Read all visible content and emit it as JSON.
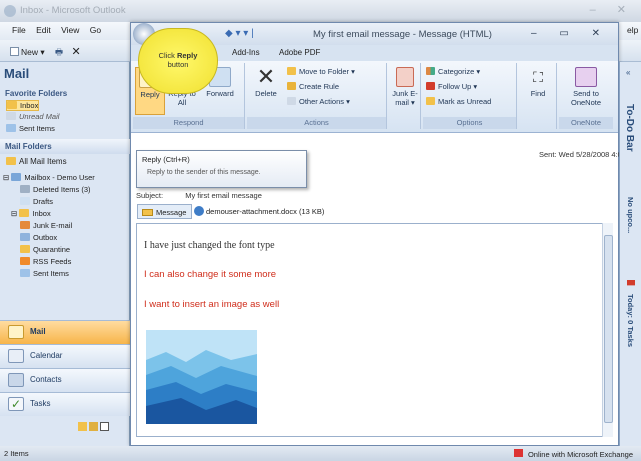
{
  "outer_window": {
    "title": "Inbox - Microsoft Outlook",
    "controls": "–  ✕"
  },
  "menu": [
    "File",
    "Edit",
    "View",
    "Go"
  ],
  "toolbar": {
    "new_label": "New",
    "help_label": "elp"
  },
  "nav": {
    "header": "Mail",
    "favorite_folders_label": "Favorite Folders",
    "favorites": [
      "Inbox",
      "Unread Mail",
      "Sent Items"
    ],
    "mail_folders_label": "Mail Folders",
    "all_mail_items": "All Mail Items",
    "mailbox_label": "Mailbox - Demo User",
    "folders": [
      "Deleted Items (3)",
      "Drafts",
      "Inbox",
      "Junk E-mail",
      "Outbox",
      "Quarantine",
      "RSS Feeds",
      "Sent Items"
    ],
    "buttons": [
      "Mail",
      "Calendar",
      "Contacts",
      "Tasks"
    ]
  },
  "message_window": {
    "title": "My first email message - Message (HTML)",
    "controls": "–  ▭  ✕",
    "tabs": [
      "Add-Ins",
      "Adobe PDF"
    ],
    "ribbon": {
      "reply": "Reply",
      "reply_all": "Reply to All",
      "forward": "Forward",
      "respond_group": "Respond",
      "delete": "Delete",
      "move_to_folder": "Move to Folder ▾",
      "create_rule": "Create Rule",
      "other_actions": "Other Actions ▾",
      "actions_group": "Actions",
      "junk_email": "Junk E-mail ▾",
      "categorize": "Categorize ▾",
      "follow_up": "Follow Up ▾",
      "mark_as_unread": "Mark as Unread",
      "options_group": "Options",
      "find": "Find",
      "send_to_onenote": "Send to OneNote",
      "onenote_group": "OneNote"
    },
    "tooltip": {
      "title": "Reply (Ctrl+R)",
      "desc": "Reply to the sender of this message."
    },
    "callout": {
      "line1": "Click",
      "bold": "Reply",
      "line2": "button"
    },
    "sent": "Sent:   Wed 5/28/2008 4:03 PM",
    "subject_label": "Subject:",
    "subject": "My first email message",
    "message_tab": "Message",
    "attachment": "demouser-attachment.docx (13 KB)",
    "body": {
      "line1": "I have just changed the font type",
      "line2": "I can also change it some more",
      "line3": "I want to insert an image as well"
    }
  },
  "todo_bar": {
    "title": "To-Do Bar",
    "appointments": "No upco...",
    "tasks": "Today: 0 Tasks"
  },
  "status": {
    "items": "2 Items",
    "connection": "Online with Microsoft Exchange"
  },
  "colors": {
    "accent": "#2a4d7a",
    "callout": "#f5e63a",
    "body_red": "#d02e1c"
  }
}
